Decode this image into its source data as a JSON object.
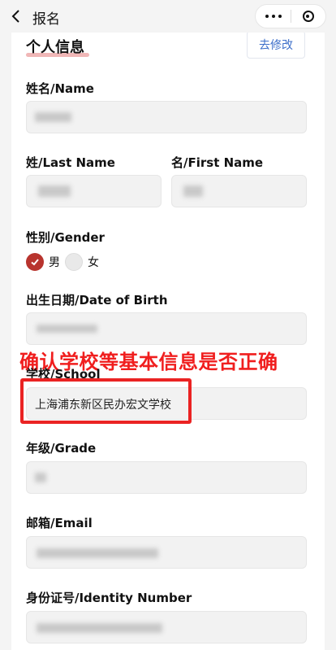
{
  "nav": {
    "title": "报名"
  },
  "section": {
    "title": "个人信息",
    "edit_label": "去修改"
  },
  "fields": {
    "name": {
      "label": "姓名/Name"
    },
    "last_name": {
      "label": "姓/Last Name"
    },
    "first_name": {
      "label": "名/First Name"
    },
    "gender": {
      "label": "性别/Gender",
      "options": [
        "男",
        "女"
      ],
      "selected": "男"
    },
    "dob": {
      "label": "出生日期/Date of Birth"
    },
    "school": {
      "label": "学校/School",
      "value": "上海浦东新区民办宏文学校"
    },
    "grade": {
      "label": "年级/Grade"
    },
    "email": {
      "label": "邮箱/Email"
    },
    "id_number": {
      "label": "身份证号/Identity Number"
    }
  },
  "annotation": {
    "text": "确认学校等基本信息是否正确"
  },
  "colors": {
    "accent": "#b8342e",
    "annotation": "#ea2323",
    "link": "#3d6fc9"
  },
  "icons": {
    "back": "chevron-left-icon",
    "more": "more-dots-icon",
    "close": "target-circle-icon"
  }
}
